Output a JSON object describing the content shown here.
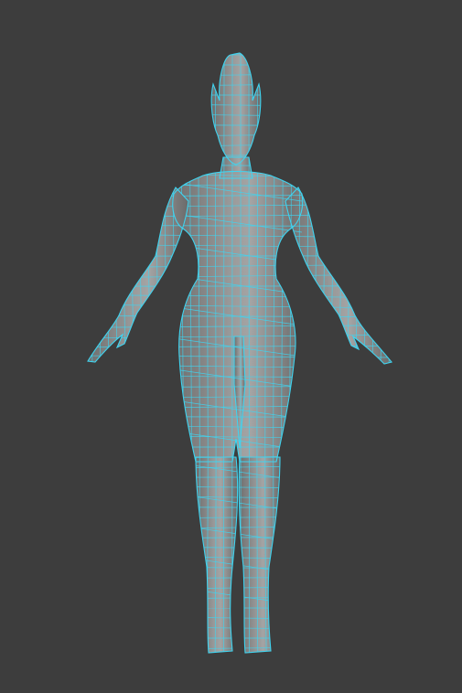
{
  "viewport": {
    "background_color": "#3d3d3d",
    "mesh_fill_color": "#8a8a8a",
    "wireframe_color": "#3fd4f0",
    "subject": "character-model"
  }
}
